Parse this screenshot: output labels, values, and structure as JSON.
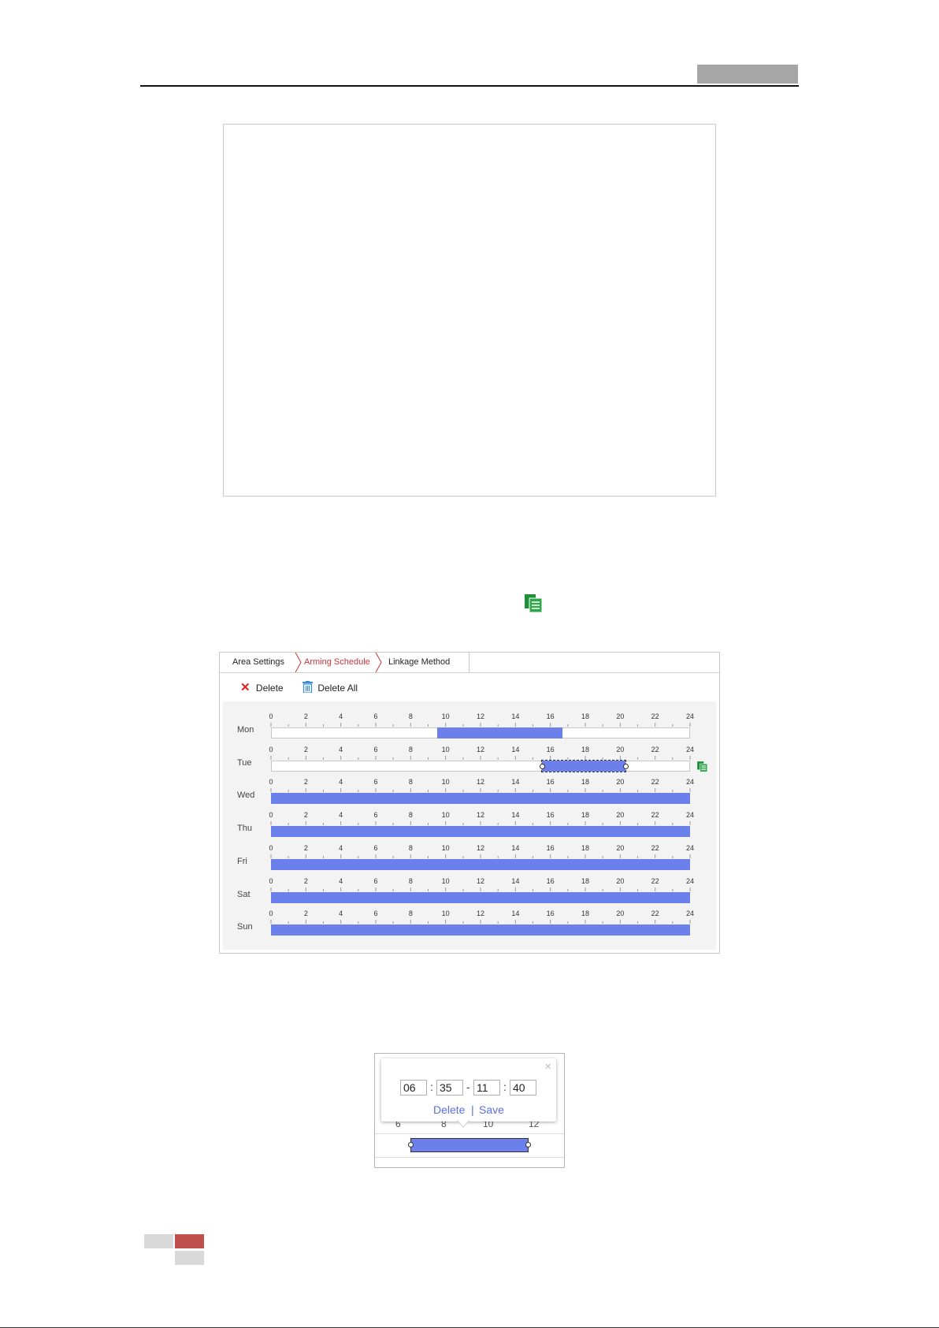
{
  "tabs": [
    {
      "label": "Area Settings"
    },
    {
      "label": "Arming Schedule"
    },
    {
      "label": "Linkage Method"
    }
  ],
  "toolbar": {
    "delete_label": "Delete",
    "delete_all_label": "Delete All"
  },
  "days": [
    "Mon",
    "Tue",
    "Wed",
    "Thu",
    "Fri",
    "Sat",
    "Sun"
  ],
  "ticks": [
    "0",
    "2",
    "4",
    "6",
    "8",
    "10",
    "12",
    "14",
    "16",
    "18",
    "20",
    "22",
    "24"
  ],
  "schedule": [
    {
      "day": "Mon",
      "segments": [
        [
          9.5,
          16.7
        ]
      ]
    },
    {
      "day": "Tue",
      "segments": [
        [
          15.5,
          20.3
        ]
      ],
      "selected": true
    },
    {
      "day": "Wed",
      "segments": [
        [
          0,
          24
        ]
      ]
    },
    {
      "day": "Thu",
      "segments": [
        [
          0,
          24
        ]
      ]
    },
    {
      "day": "Fri",
      "segments": [
        [
          0,
          24
        ]
      ]
    },
    {
      "day": "Sat",
      "segments": [
        [
          0,
          24
        ]
      ]
    },
    {
      "day": "Sun",
      "segments": [
        [
          0,
          24
        ]
      ]
    }
  ],
  "popup": {
    "start_hour": "06",
    "start_minute": "35",
    "end_hour": "11",
    "end_minute": "40",
    "delete_label": "Delete",
    "divider": "|",
    "save_label": "Save",
    "close": "×",
    "ticks": [
      "6",
      "8",
      "10",
      "12"
    ]
  },
  "colors": {
    "schedule_bar": "#6b80ea",
    "active_tab": "#cc3333",
    "footer_accent": "#c0504d",
    "copy_icon": "#2ea84a"
  }
}
